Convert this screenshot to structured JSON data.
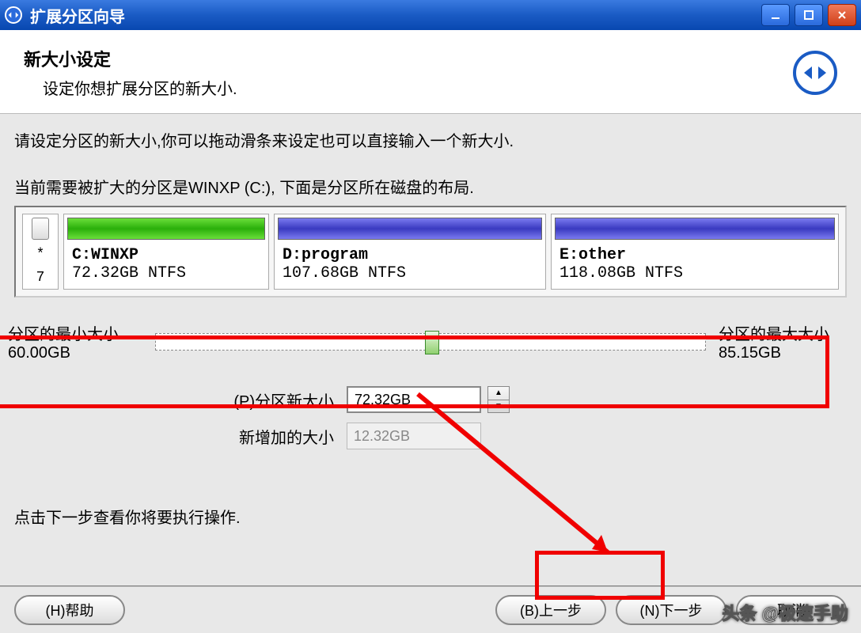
{
  "window": {
    "title": "扩展分区向导"
  },
  "header": {
    "heading": "新大小设定",
    "subheading": "设定你想扩展分区的新大小."
  },
  "body": {
    "instruction": "请设定分区的新大小,你可以拖动滑条来设定也可以直接输入一个新大小.",
    "current_partition_prefix": "当前需要被扩大的分区是",
    "current_partition_name": "WINXP (C:)",
    "current_partition_suffix": ", 下面是分区所在磁盘的布局.",
    "footer_note": "点击下一步查看你将要执行操作."
  },
  "disk": {
    "head_symbol": "*",
    "head_num": "7",
    "partitions": [
      {
        "label": "C:WINXP",
        "size": "72.32GB NTFS",
        "color": "green"
      },
      {
        "label": "D:program",
        "size": "107.68GB NTFS",
        "color": "blue"
      },
      {
        "label": "E:other",
        "size": "118.08GB NTFS",
        "color": "blue"
      }
    ]
  },
  "slider": {
    "min_label": "分区的最小大小",
    "min_value": "60.00GB",
    "max_label": "分区的最大大小",
    "max_value": "85.15GB"
  },
  "fields": {
    "new_size_label": "(P)分区新大小",
    "new_size_value": "72.32GB",
    "added_label": "新增加的大小",
    "added_value": "12.32GB"
  },
  "buttons": {
    "help": "(H)帮助",
    "back": "(B)上一步",
    "next": "(N)下一步",
    "cancel": "取消"
  },
  "watermark": "头条 @极速手助"
}
